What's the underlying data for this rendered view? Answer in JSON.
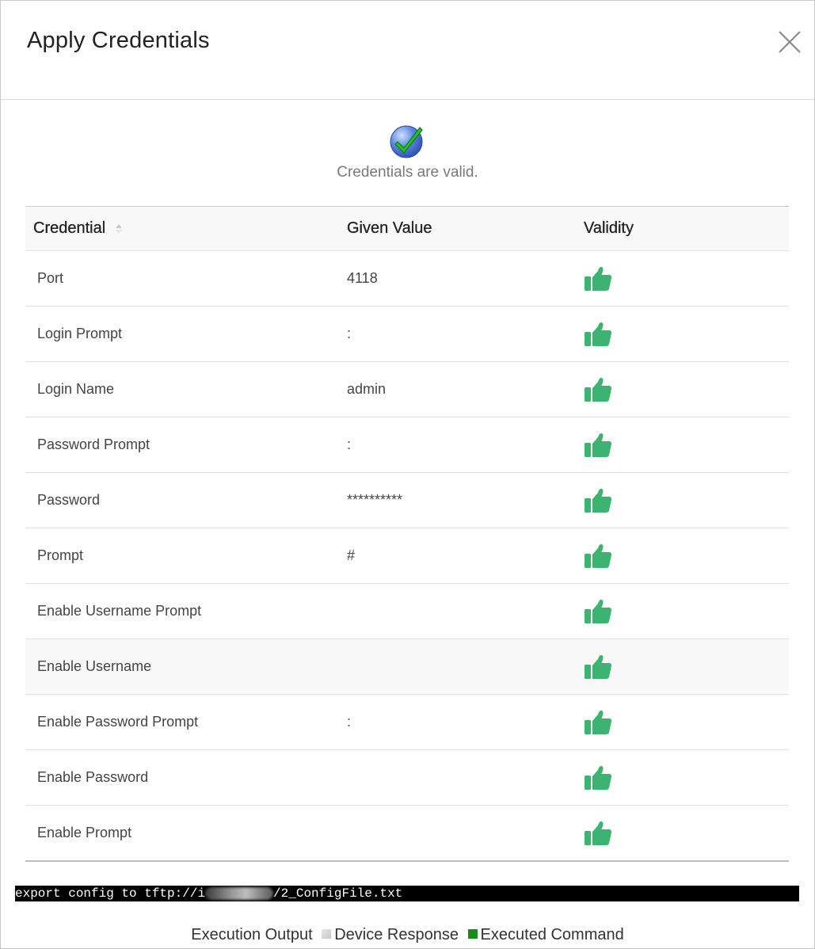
{
  "dialog": {
    "title": "Apply Credentials",
    "close_icon": "close-icon"
  },
  "status": {
    "icon": "check-circle-icon",
    "message": "Credentials are valid."
  },
  "table": {
    "headers": [
      "Credential",
      "Given Value",
      "Validity"
    ],
    "rows": [
      {
        "credential": "Port",
        "value": "4118",
        "validity": "valid"
      },
      {
        "credential": "Login Prompt",
        "value": ":",
        "validity": "valid"
      },
      {
        "credential": "Login Name",
        "value": "admin",
        "validity": "valid"
      },
      {
        "credential": "Password Prompt",
        "value": ":",
        "validity": "valid"
      },
      {
        "credential": "Password",
        "value": "**********",
        "validity": "valid"
      },
      {
        "credential": "Prompt",
        "value": "#",
        "validity": "valid"
      },
      {
        "credential": "Enable Username Prompt",
        "value": "",
        "validity": "valid"
      },
      {
        "credential": "Enable Username",
        "value": "",
        "validity": "valid"
      },
      {
        "credential": "Enable Password Prompt",
        "value": ":",
        "validity": "valid"
      },
      {
        "credential": "Enable Password",
        "value": "",
        "validity": "valid"
      },
      {
        "credential": "Enable Prompt",
        "value": "",
        "validity": "valid"
      }
    ]
  },
  "console": {
    "prefix": "export config to tftp://i",
    "suffix": "/2_ConfigFile.txt"
  },
  "legend": {
    "label": "Execution Output",
    "items": [
      {
        "label": "Device Response",
        "color": "#c8c8c8"
      },
      {
        "label": "Executed Command",
        "color": "#1a8a1a"
      }
    ]
  },
  "colors": {
    "thumb": "#3cb371",
    "header_bg": "#f8f8f8"
  }
}
